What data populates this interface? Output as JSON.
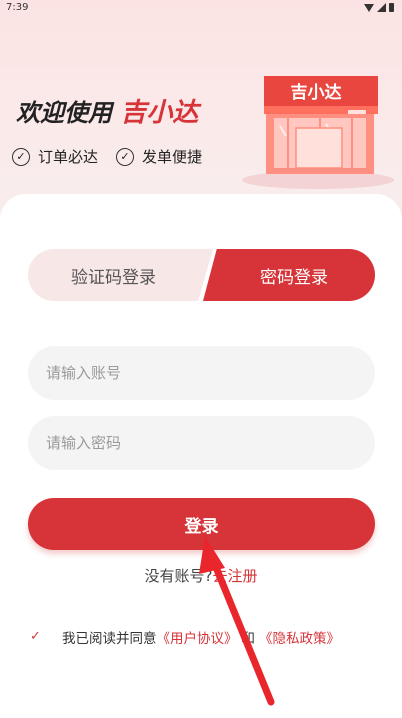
{
  "status_bar": {
    "time": "7:39"
  },
  "hero": {
    "welcome_prefix": "欢迎使用",
    "brand": "吉小达",
    "features": [
      "订单必达",
      "发单便捷"
    ],
    "store_sign": "吉小达"
  },
  "tabs": {
    "sms_login": "验证码登录",
    "password_login": "密码登录",
    "active": "password_login"
  },
  "form": {
    "account_placeholder": "请输入账号",
    "password_placeholder": "请输入密码",
    "account_value": "",
    "password_value": ""
  },
  "actions": {
    "login_label": "登录",
    "no_account_text": "没有账号?",
    "register_link": "去注册"
  },
  "agreement": {
    "checked": true,
    "prefix": "我已阅读并同意",
    "user_agreement": "《用户协议》",
    "and": "和",
    "privacy_policy": "《隐私政策》"
  },
  "colors": {
    "accent": "#d63438",
    "hero_bg": "#fbe3e3"
  }
}
